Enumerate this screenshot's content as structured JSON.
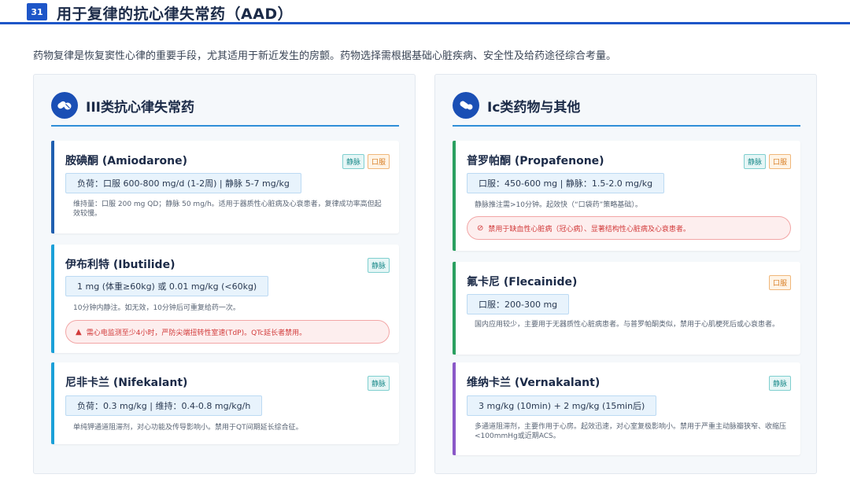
{
  "header": {
    "page_number": "31",
    "title": "用于复律的抗心律失常药（AAD）"
  },
  "intro": "药物复律是恢复窦性心律的重要手段，尤其适用于新近发生的房颤。药物选择需根据基础心脏疾病、安全性及给药途径综合考量。",
  "colors": {
    "accent": "#1e56c8",
    "blue": "#1f5fb0",
    "cyan": "#1aa0d8",
    "green": "#2aa060",
    "purple": "#8a58c8",
    "iv_tag": "#1a8a8a",
    "po_tag": "#d9822b",
    "warning": "#d23a3a"
  },
  "left_panel": {
    "title": "III类抗心律失常药",
    "icon": "pills-icon",
    "drugs": [
      {
        "name": "胺碘酮 (Amiodarone)",
        "tags": [
          "静脉",
          "口服"
        ],
        "dose": "负荷：口服 600-800 mg/d (1-2周) | 静脉 5-7 mg/kg",
        "note": "维持量：口服 200 mg QD；静脉 50 mg/h。适用于器质性心脏病及心衰患者，复律成功率高但起效较慢。"
      },
      {
        "name": "伊布利特 (Ibutilide)",
        "tags": [
          "静脉"
        ],
        "dose": "1 mg (体重≥60kg) 或 0.01 mg/kg (<60kg)",
        "note": "10分钟内静注。如无效，10分钟后可重复给药一次。",
        "warning": "需心电监测至少4小时，严防尖端扭转性室速(TdP)。QTc延长者禁用。"
      },
      {
        "name": "尼非卡兰 (Nifekalant)",
        "tags": [
          "静脉"
        ],
        "dose": "负荷：0.3 mg/kg | 维持：0.4-0.8 mg/kg/h",
        "note": "单纯钾通道阻滞剂，对心功能及传导影响小。禁用于QT间期延长综合征。"
      }
    ]
  },
  "right_panel": {
    "title": "Ic类药物与其他",
    "icon": "capsule-icon",
    "drugs": [
      {
        "name": "普罗帕酮 (Propafenone)",
        "tags": [
          "静脉",
          "口服"
        ],
        "dose": "口服：450-600 mg | 静脉：1.5-2.0 mg/kg",
        "note": "静脉推注需>10分钟。起效快（“口袋药”策略基础）。",
        "warning": "禁用于缺血性心脏病（冠心病）、显著结构性心脏病及心衰患者。"
      },
      {
        "name": "氟卡尼 (Flecainide)",
        "tags": [
          "口服"
        ],
        "dose": "口服：200-300 mg",
        "note": "国内应用较少，主要用于无器质性心脏病患者。与普罗帕酮类似，禁用于心肌梗死后或心衰患者。"
      },
      {
        "name": "维纳卡兰 (Vernakalant)",
        "tags": [
          "静脉"
        ],
        "dose": "3 mg/kg (10min) + 2 mg/kg (15min后)",
        "note": "多通道阻滞剂，主要作用于心房。起效迅速，对心室复极影响小。禁用于严重主动脉瓣狭窄、收缩压<100mmHg或近期ACS。"
      }
    ]
  }
}
